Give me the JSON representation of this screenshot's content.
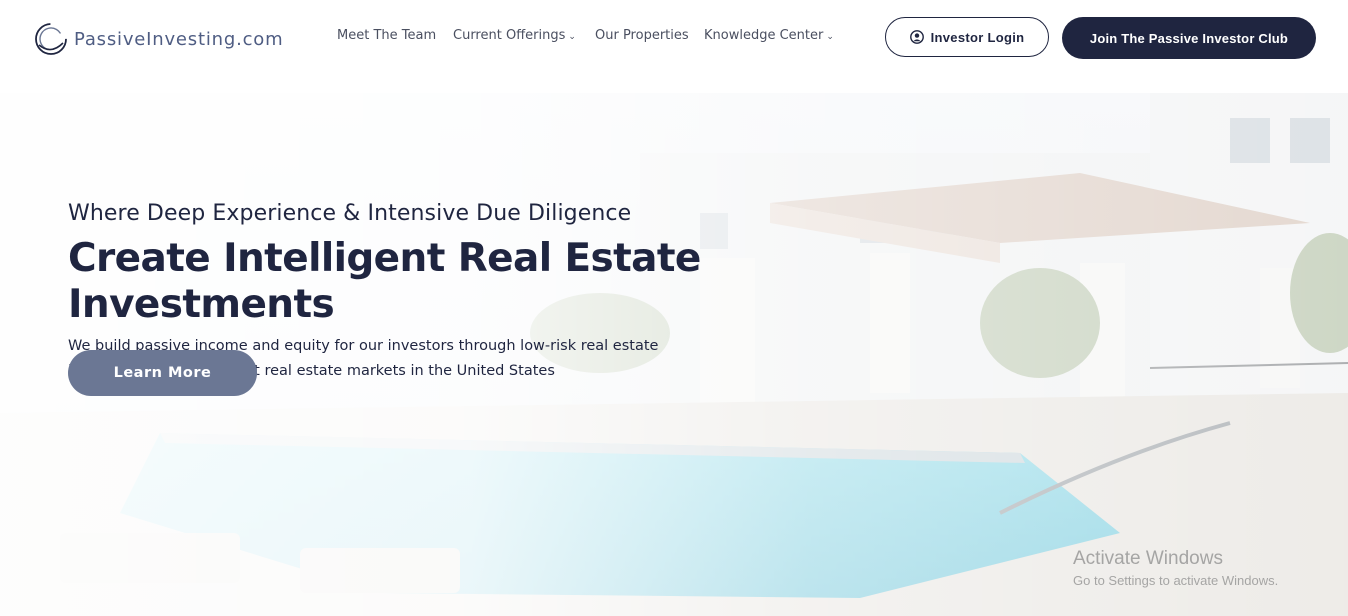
{
  "header": {
    "logo_text": "PassiveInvesting.com",
    "nav": [
      {
        "label": "Meet The Team",
        "dropdown": false
      },
      {
        "label": "Current Offerings",
        "dropdown": true
      },
      {
        "label": "Our Properties",
        "dropdown": false
      },
      {
        "label": "Knowledge Center",
        "dropdown": true
      }
    ],
    "login_label": "Investor Login",
    "login_icon": "user-circle-icon",
    "join_label": "Join The Passive Investor Club"
  },
  "hero": {
    "kicker": "Where Deep Experience & Intensive Due Diligence",
    "title": "Create Intelligent Real Estate Investments",
    "description": "We build passive income and equity for our investors through low-risk real estate investments in the hottest real estate markets in the United States",
    "cta_label": "Learn More"
  },
  "watermark": {
    "title": "Activate Windows",
    "subtitle": "Go to Settings to activate Windows."
  },
  "colors": {
    "navy": "#1f2540",
    "cta": "#6b7794",
    "logo_text": "#4f5d83",
    "pool_water": "#7fd3e3"
  }
}
